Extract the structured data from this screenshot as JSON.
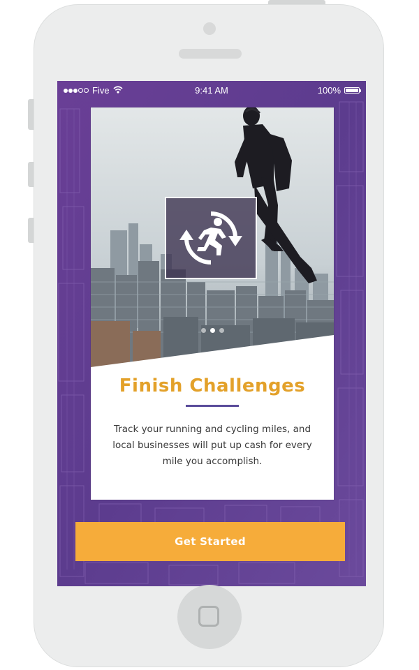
{
  "status_bar": {
    "carrier": "Five",
    "time": "9:41 AM",
    "battery": "100%",
    "signal_dots_filled": 3,
    "signal_dots_total": 5
  },
  "onboarding": {
    "hero_icon": "runner-cycle-icon",
    "title": "Finish Challenges",
    "body": "Track your running and cycling miles, and local businesses will put up cash for every mile you accomplish.",
    "page_count": 3,
    "active_page": 2
  },
  "cta": {
    "label": "Get Started"
  },
  "colors": {
    "accent_orange": "#f6ac3a",
    "title_gold": "#e3a12a",
    "rule_purple": "#5a4c9a",
    "screen_purple": "#5f3d8f"
  }
}
